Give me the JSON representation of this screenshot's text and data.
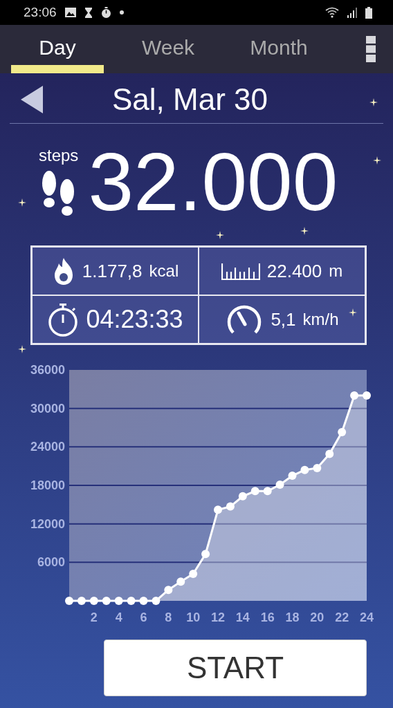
{
  "status_bar": {
    "time": "23:06"
  },
  "tabs": [
    {
      "label": "Day",
      "selected": true
    },
    {
      "label": "Week",
      "selected": false
    },
    {
      "label": "Month",
      "selected": false
    }
  ],
  "date": "Sal, Mar 30",
  "steps": {
    "label": "steps",
    "value": "32.000"
  },
  "stats": [
    {
      "kind": "calories",
      "value": "1.177,8",
      "unit": "kcal"
    },
    {
      "kind": "distance",
      "value": "22.400",
      "unit": "m"
    },
    {
      "kind": "time",
      "value": "04:23:33"
    },
    {
      "kind": "speed",
      "value": "5,1",
      "unit": "km/h"
    }
  ],
  "chart": {
    "chart_data": {
      "type": "area",
      "x": [
        0,
        1,
        2,
        3,
        4,
        5,
        6,
        7,
        8,
        9,
        10,
        11,
        12,
        13,
        14,
        15,
        16,
        17,
        18,
        19,
        20,
        21,
        22,
        23,
        24
      ],
      "grid": true,
      "series": [
        {
          "color": "#ffffff",
          "values": [
            0,
            0,
            0,
            0,
            0,
            0,
            0,
            0,
            1700,
            3000,
            4200,
            7300,
            14200,
            14700,
            16300,
            17100,
            17100,
            18100,
            19500,
            20400,
            20700,
            22900,
            26300,
            32000,
            32000
          ]
        }
      ],
      "xlim": [
        0,
        24
      ],
      "ylim": [
        0,
        36000
      ],
      "xticks": [
        2,
        4,
        6,
        8,
        10,
        12,
        14,
        16,
        18,
        20,
        22,
        24
      ],
      "yticks": [
        6000,
        12000,
        18000,
        24000,
        30000,
        36000
      ]
    }
  },
  "start_button": "START"
}
